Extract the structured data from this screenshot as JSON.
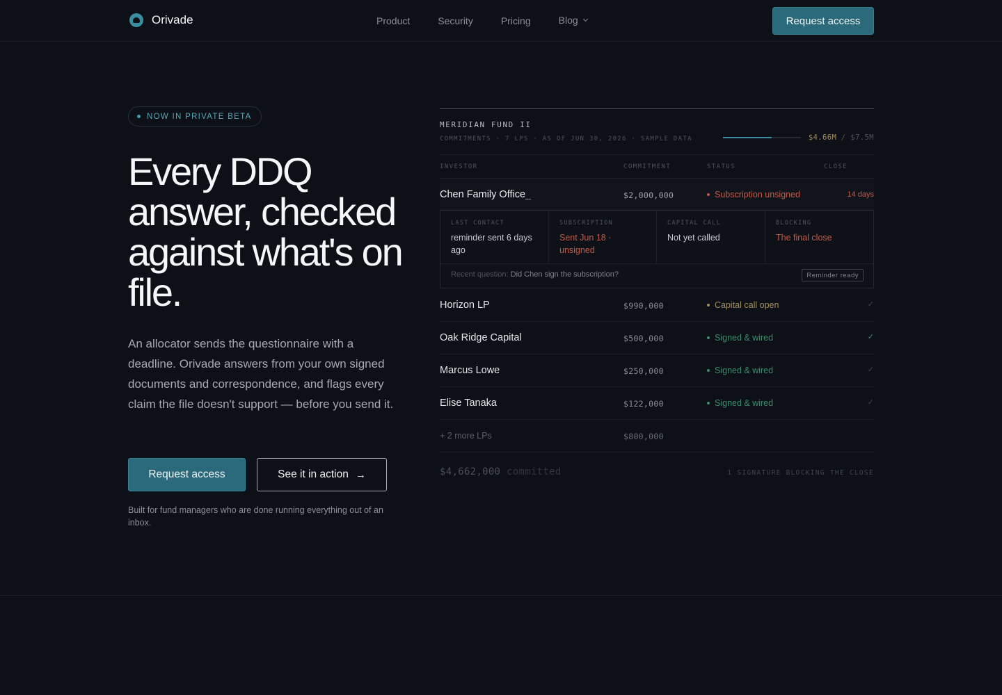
{
  "nav": {
    "brand": "Orivade",
    "links": [
      "Product",
      "Security",
      "Pricing",
      "Blog"
    ],
    "cta": "Request access"
  },
  "hero": {
    "badge": "NOW IN PRIVATE BETA",
    "headline": "Every DDQ answer, checked against what's on file.",
    "subhead": "An allocator sends the questionnaire with a deadline. Orivade answers from your own signed documents and correspondence, and flags every claim the file doesn't support — before you send it.",
    "primary_cta": "Request access",
    "secondary_cta": "See it in action",
    "footnote": "Built for fund managers who are done running everything out of an inbox."
  },
  "panel": {
    "fund": "MERIDIAN FUND II",
    "meta": "COMMITMENTS · 7 LPS · AS OF JUN 30, 2026 · SAMPLE DATA",
    "committed": "$4.66M",
    "separator": "/",
    "target": "$7.5M",
    "progress_fraction": 0.6213,
    "columns": [
      "INVESTOR",
      "COMMITMENT",
      "STATUS",
      "CLOSE"
    ],
    "active": {
      "name": "Chen Family Office",
      "cursor": "_",
      "amount": "$2,000,000",
      "status": "Subscription unsigned",
      "close": "14 days",
      "details": [
        {
          "label": "LAST CONTACT",
          "value": "reminder sent 6 days ago"
        },
        {
          "label": "SUBSCRIPTION",
          "value": "Sent Jun 18 · unsigned"
        },
        {
          "label": "CAPITAL CALL",
          "value": "Not yet called"
        },
        {
          "label": "BLOCKING",
          "value": "The final close"
        }
      ],
      "recent_label": "Recent question:",
      "recent_question": "Did Chen sign the subscription?",
      "reminder": "Reminder ready"
    },
    "rows": [
      {
        "name": "Horizon LP",
        "amount": "$990,000",
        "status": "Capital call open",
        "mark": "✓"
      },
      {
        "name": "Oak Ridge Capital",
        "amount": "$500,000",
        "status": "Signed & wired",
        "mark": "✓"
      },
      {
        "name": "Marcus Lowe",
        "amount": "$250,000",
        "status": "Signed & wired",
        "mark": "✓"
      },
      {
        "name": "Elise Tanaka",
        "amount": "$122,000",
        "status": "Signed & wired",
        "mark": "✓"
      }
    ],
    "more": {
      "label": "+ 2 more LPs",
      "amount": "$800,000"
    },
    "total": "$4,662,000",
    "total_suffix": "committed",
    "blocking_note": "1 SIGNATURE BLOCKING THE CLOSE"
  },
  "colors": {
    "accent": "#2b6a7a",
    "danger": "#c25a4a",
    "warning": "#a38e5f",
    "success": "#3d8c6c"
  }
}
